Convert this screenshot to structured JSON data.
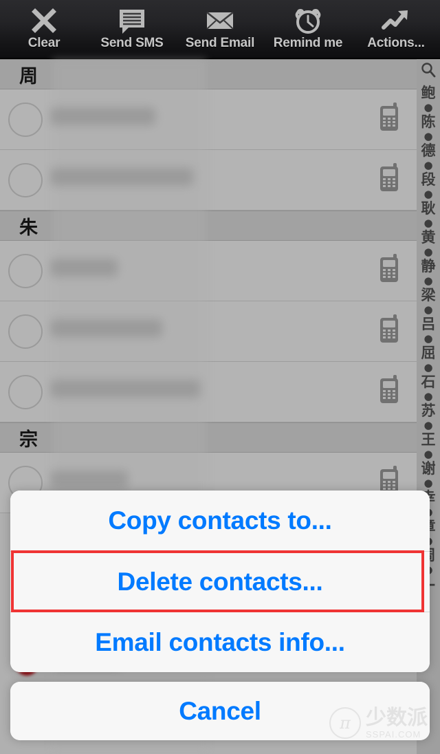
{
  "toolbar": {
    "items": [
      {
        "label": "Clear",
        "icon": "close-x-icon"
      },
      {
        "label": "Send SMS",
        "icon": "speech-bubble-icon"
      },
      {
        "label": "Send Email",
        "icon": "envelope-icon"
      },
      {
        "label": "Remind me",
        "icon": "alarm-clock-icon"
      },
      {
        "label": "Actions...",
        "icon": "trending-arrow-icon"
      }
    ]
  },
  "list": {
    "sections": [
      {
        "title": "周",
        "rows": [
          {
            "name_redacted": true,
            "phone_icon": "mobile-phone-icon"
          },
          {
            "name_redacted": true,
            "phone_icon": "mobile-phone-icon"
          }
        ]
      },
      {
        "title": "朱",
        "rows": [
          {
            "name_redacted": true,
            "phone_icon": "mobile-phone-icon"
          },
          {
            "name_redacted": true,
            "phone_icon": "mobile-phone-icon"
          },
          {
            "name_redacted": true,
            "phone_icon": "mobile-phone-icon"
          }
        ]
      },
      {
        "title": "宗",
        "rows": [
          {
            "name_redacted": true,
            "phone_icon": "mobile-phone-icon"
          }
        ]
      }
    ]
  },
  "index_bar": {
    "search_glyph": "⌕",
    "entries": [
      "鲍",
      "●",
      "陈",
      "●",
      "德",
      "●",
      "段",
      "●",
      "耿",
      "●",
      "黄",
      "●",
      "静",
      "●",
      "梁",
      "●",
      "吕",
      "●",
      "屈",
      "●",
      "石",
      "●",
      "苏",
      "●",
      "王",
      "●",
      "谢",
      "●",
      "幸",
      "●",
      "章",
      "●",
      "周",
      "●",
      "—"
    ]
  },
  "action_sheet": {
    "buttons": [
      {
        "label": "Copy contacts to...",
        "highlighted": false
      },
      {
        "label": "Delete contacts...",
        "highlighted": true
      },
      {
        "label": "Email contacts info...",
        "highlighted": false
      }
    ],
    "cancel_label": "Cancel",
    "highlight_color": "#ef3434",
    "button_text_color": "#007aff"
  },
  "watermark": {
    "logo_glyph": "π",
    "cn": "少数派",
    "en": "SSPAI.COM"
  }
}
